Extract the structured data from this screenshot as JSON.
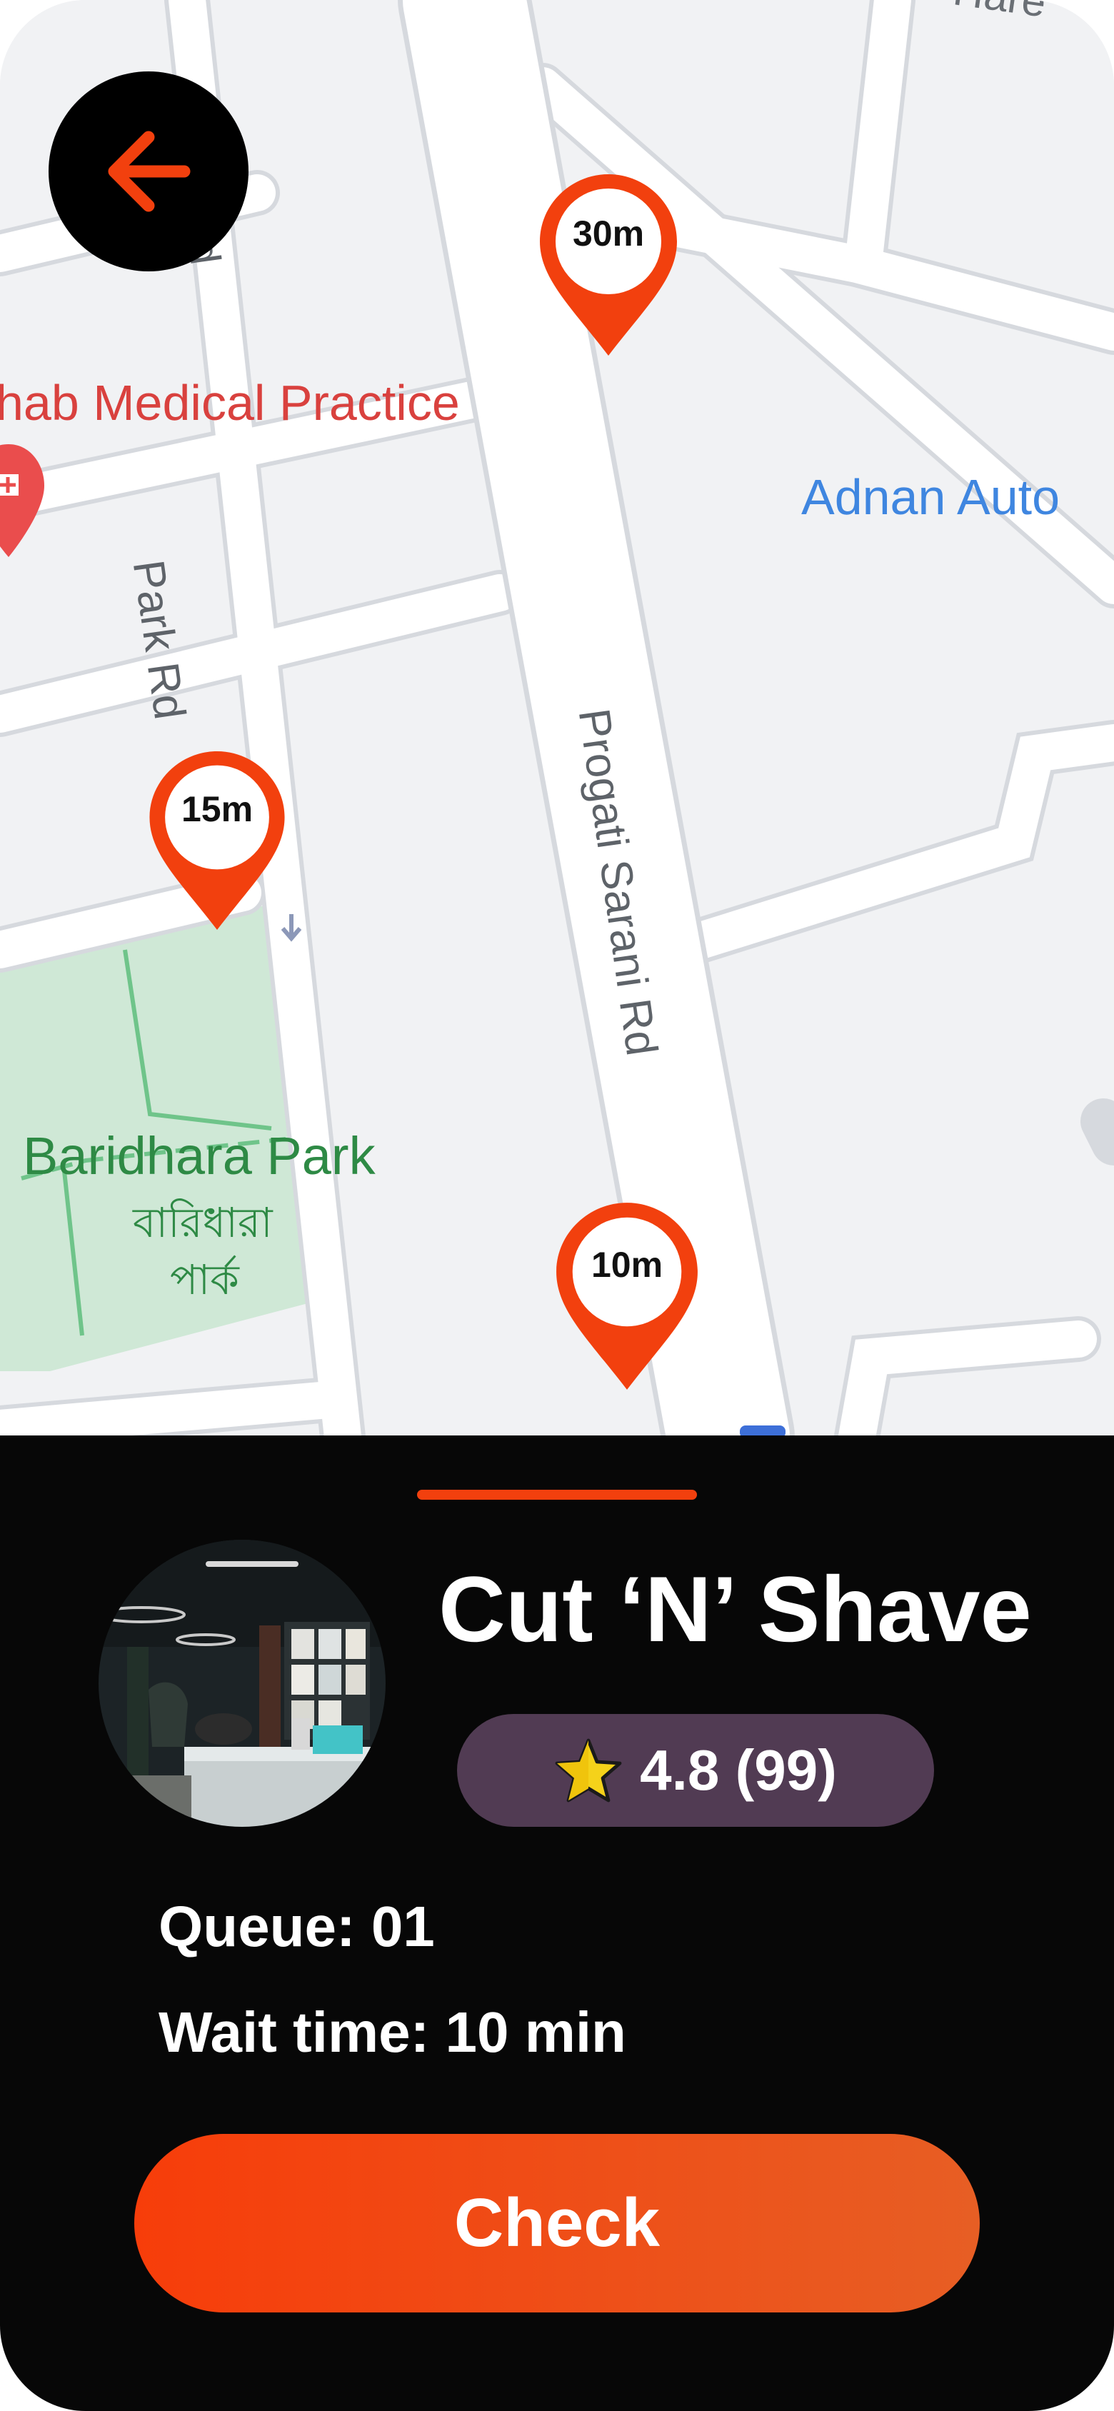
{
  "map": {
    "labels": {
      "medical": "hab Medical Practice",
      "adnan": "Adnan Auto",
      "top_right": "Hare",
      "park_rd": "Park Rd",
      "road_fragment": "d",
      "progati": "Progati Sarani Rd",
      "park_en": "Baridhara Park",
      "park_bn_line1": "বারিধারা",
      "park_bn_line2": "পার্ক"
    },
    "pins": [
      {
        "label": "30m"
      },
      {
        "label": "15m"
      },
      {
        "label": "10m"
      }
    ]
  },
  "back_button": {
    "icon": "arrow-left-icon"
  },
  "shop": {
    "name": "Cut ‘N’ Shave",
    "rating": "4.8 (99)",
    "queue": "Queue: 01",
    "wait_time": "Wait time: 10 min",
    "check_label": "Check"
  },
  "colors": {
    "accent": "#f2400e",
    "sheet_bg": "#070707",
    "rating_bg": "#513b53",
    "star": "#f5d21a",
    "map_bg": "#f1f2f4",
    "park": "#cfe8d6"
  }
}
